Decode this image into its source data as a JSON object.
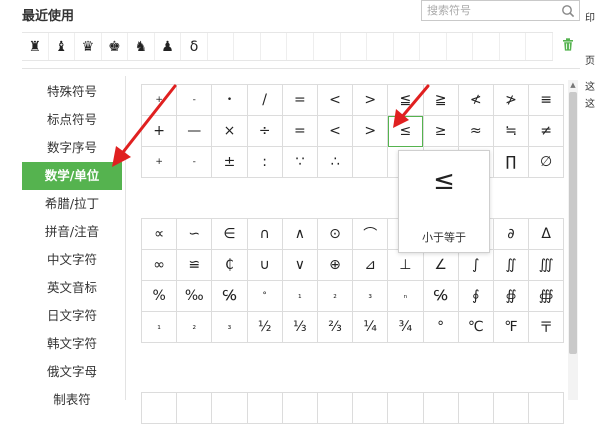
{
  "recent": {
    "title": "最近使用",
    "symbols": [
      "♜",
      "♝",
      "♛",
      "♚",
      "♞",
      "♟",
      "δ",
      "",
      "",
      "",
      "",
      "",
      "",
      "",
      "",
      "",
      "",
      "",
      "",
      ""
    ]
  },
  "search": {
    "placeholder": "搜索符号"
  },
  "edge_fragments": [
    "印",
    "页",
    "这",
    "这"
  ],
  "sidebar": {
    "items": [
      {
        "label": "特殊符号"
      },
      {
        "label": "标点符号"
      },
      {
        "label": "数字序号"
      },
      {
        "label": "数学/单位",
        "active": true
      },
      {
        "label": "希腊/拉丁"
      },
      {
        "label": "拼音/注音"
      },
      {
        "label": "中文字符"
      },
      {
        "label": "英文音标"
      },
      {
        "label": "日文字符"
      },
      {
        "label": "韩文字符"
      },
      {
        "label": "俄文字母"
      },
      {
        "label": "制表符"
      }
    ]
  },
  "grid_top": [
    [
      "+",
      "-",
      "•",
      "/",
      "=",
      "<",
      ">",
      "≦",
      "≧",
      "≮",
      "≯",
      "≡"
    ],
    [
      "+",
      "—",
      "×",
      "÷",
      "=",
      "<",
      ">",
      "≤",
      "≥",
      "≈",
      "≒",
      "≠"
    ],
    [
      "+",
      "-",
      "±",
      ":",
      "∵",
      "∴",
      "",
      "",
      "",
      "",
      "∏",
      "∅"
    ]
  ],
  "grid_bottom": [
    [
      "∝",
      "∽",
      "∈",
      "∩",
      "∧",
      "⊙",
      "⌒",
      "",
      "",
      "",
      "∂",
      "Δ"
    ],
    [
      "∞",
      "≌",
      "₵",
      "∪",
      "∨",
      "⊕",
      "⊿",
      "⊥",
      "∠",
      "∫",
      "∬",
      "∭"
    ],
    [
      "%",
      "‰",
      "℅",
      "°",
      "₁",
      "₂",
      "₃",
      "ₙ",
      "℅",
      "∮",
      "∯",
      "∰"
    ],
    [
      "₁",
      "₂",
      "₃",
      "½",
      "⅓",
      "⅔",
      "¼",
      "¾",
      "°",
      "℃",
      "℉",
      "〒"
    ]
  ],
  "grid_third": [
    [
      "",
      "",
      "",
      "",
      "",
      "",
      "",
      "",
      "",
      "",
      "",
      ""
    ]
  ],
  "tooltip": {
    "glyph": "≤",
    "label": "小于等于"
  },
  "colors": {
    "accent": "#55b34f",
    "arrow": "#e02020"
  }
}
